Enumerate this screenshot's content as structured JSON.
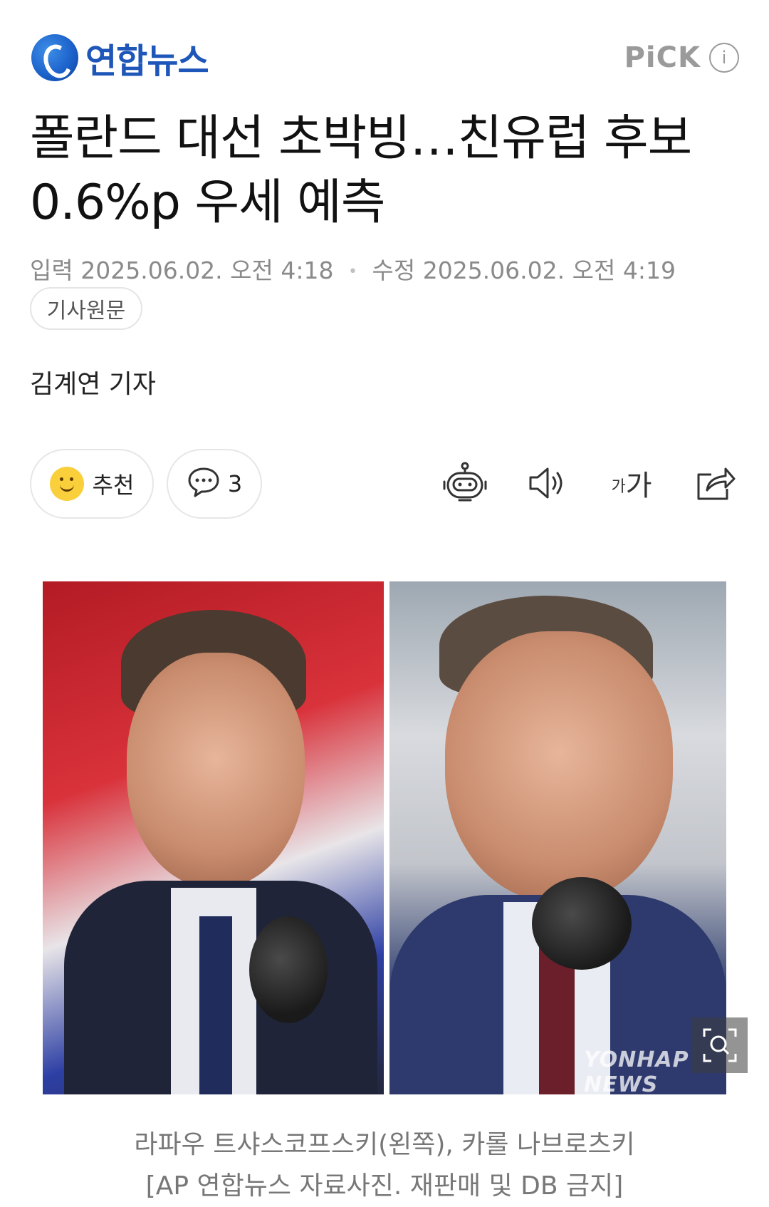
{
  "header": {
    "brand": "연합뉴스",
    "pick_label": "PiCK",
    "info_icon": "i"
  },
  "article": {
    "title_line1": "폴란드 대선 초박빙…친유럽 후보",
    "title_line2": "0.6%p 우세 예측",
    "input_label": "입력",
    "input_time": "2025.06.02. 오전 4:18",
    "modified_label": "수정",
    "modified_time": "2025.06.02. 오전 4:19",
    "original_button": "기사원문",
    "reporter": "김계연 기자"
  },
  "reactions": {
    "like_label": "추천",
    "comment_count": "3"
  },
  "tools": {
    "font_size_small": "가",
    "font_size_large": "가"
  },
  "photo": {
    "watermark": "YONHAP NEWS",
    "caption_line1": "라파우 트샤스코프스키(왼쪽), 카롤 나브로츠키",
    "caption_line2": "[AP 연합뉴스 자료사진. 재판매 및 DB 금지]"
  },
  "colors": {
    "brand_blue": "#1e56b9",
    "muted_text": "#8a8a8a",
    "pick_gray": "#9a9a9a"
  }
}
